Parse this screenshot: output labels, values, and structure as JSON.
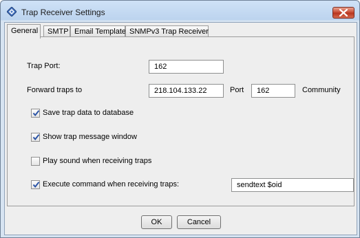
{
  "window": {
    "title": "Trap Receiver Settings"
  },
  "tabs": [
    {
      "label": "General",
      "active": true
    },
    {
      "label": "SMTP",
      "active": false
    },
    {
      "label": "Email Template",
      "active": false
    },
    {
      "label": "SNMPv3 Trap Receiver",
      "active": false
    }
  ],
  "general": {
    "trap_port_label": "Trap Port:",
    "trap_port_value": "162",
    "forward_label": "Forward traps to",
    "forward_ip_value": "218.104.133.22",
    "port_label": "Port",
    "forward_port_value": "162",
    "community_label": "Community",
    "save_db_label": "Save trap data to database",
    "save_db_checked": true,
    "show_window_label": "Show trap message window",
    "show_window_checked": true,
    "play_sound_label": "Play sound when receiving traps",
    "play_sound_checked": false,
    "exec_cmd_label": "Execute command when receiving traps:",
    "exec_cmd_checked": true,
    "exec_cmd_value": "sendtext $oid"
  },
  "buttons": {
    "ok": "OK",
    "cancel": "Cancel"
  },
  "colors": {
    "check_blue": "#2b54a6",
    "close_red": "#c6462f"
  }
}
